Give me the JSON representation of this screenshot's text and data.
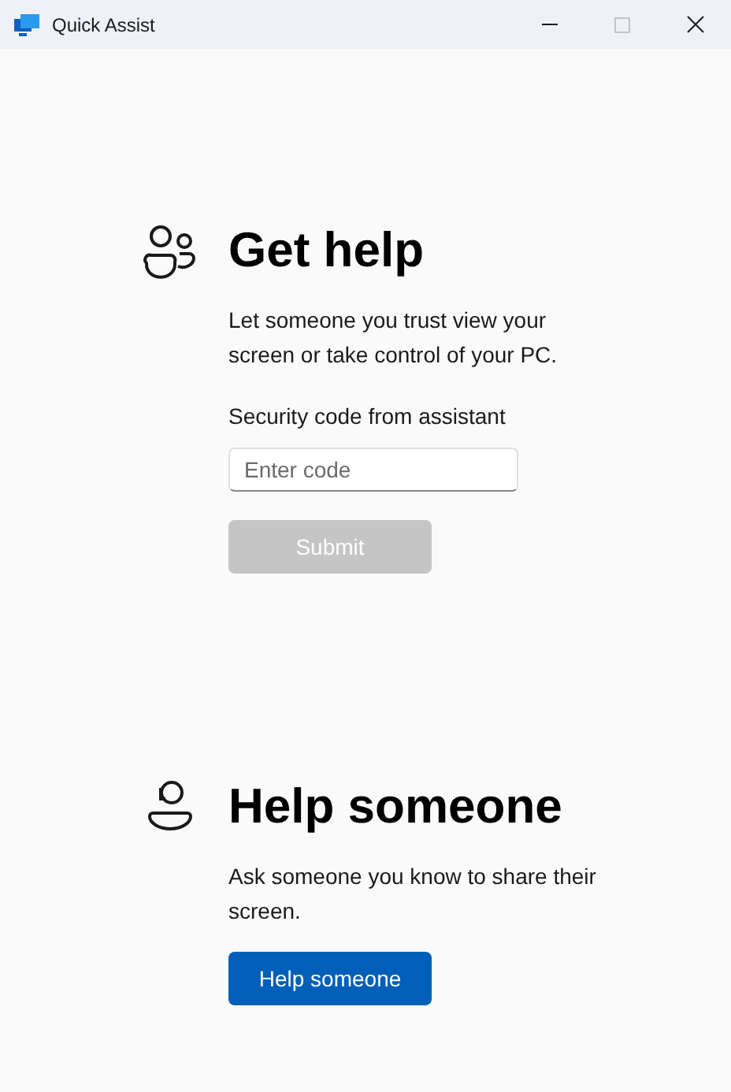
{
  "window": {
    "title": "Quick Assist",
    "controls": [
      {
        "kind": "minimize",
        "disabled": false
      },
      {
        "kind": "maximize",
        "disabled": true
      },
      {
        "kind": "close",
        "disabled": false
      }
    ]
  },
  "sections": [
    {
      "kind": "get-help",
      "heading": "Get help",
      "description": "Let someone you trust view your screen or take control of your PC.",
      "field": {
        "label": "Security code from assistant",
        "placeholder": "Enter code"
      },
      "button": {
        "label": "Submit",
        "disabled": true
      }
    },
    {
      "kind": "help-someone",
      "heading": "Help someone",
      "description": "Ask someone you know to share their screen.",
      "button": {
        "label": "Help someone",
        "disabled": false
      }
    }
  ]
}
